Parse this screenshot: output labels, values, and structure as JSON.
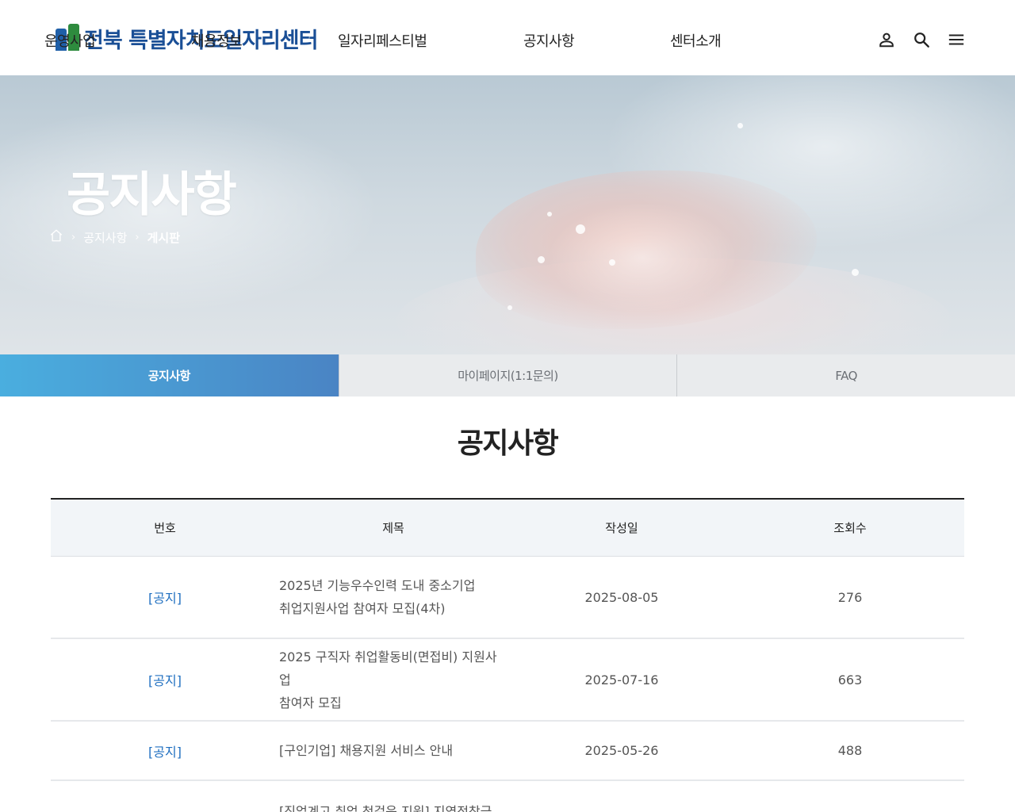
{
  "header": {
    "logo_text": "전북 특별자치도일자리센터",
    "nav": [
      "운영사업",
      "채용정보",
      "일자리페스티벌",
      "공지사항",
      "센터소개"
    ],
    "icons": [
      "user-icon",
      "search-icon",
      "menu-icon"
    ]
  },
  "hero": {
    "title": "공지사항",
    "breadcrumb": [
      "공지사항",
      "게시판"
    ]
  },
  "tabs": [
    "공지사항",
    "마이페이지(1:1문의)",
    "FAQ"
  ],
  "main": {
    "heading": "공지사항",
    "table": {
      "columns": [
        "번호",
        "제목",
        "작성일",
        "조회수"
      ],
      "rows": [
        {
          "no": "[공지]",
          "title_line1": "2025년 기능우수인력 도내 중소기업",
          "title_line2": "취업지원사업 참여자 모집(4차)",
          "date": "2025-08-05",
          "views": "276"
        },
        {
          "no": "[공지]",
          "title_line1": "2025 구직자 취업활동비(면접비) 지원사업",
          "title_line2": "참여자 모집",
          "date": "2025-07-16",
          "views": "663"
        },
        {
          "no": "[공지]",
          "title_line1": "[구인기업] 채용지원 서비스 안내",
          "title_line2": "",
          "date": "2025-05-26",
          "views": "488"
        },
        {
          "no": "",
          "title_line1": "[직업계고 취업 첫걸음 지원] 지역정착금",
          "title_line2": "",
          "date": "",
          "views": ""
        }
      ]
    }
  },
  "colors": {
    "accent": "#4a9fd8",
    "notice_blue": "#1f6fc0",
    "logo_blue": "#1a4f96",
    "logo_green": "#2e8b3e"
  }
}
